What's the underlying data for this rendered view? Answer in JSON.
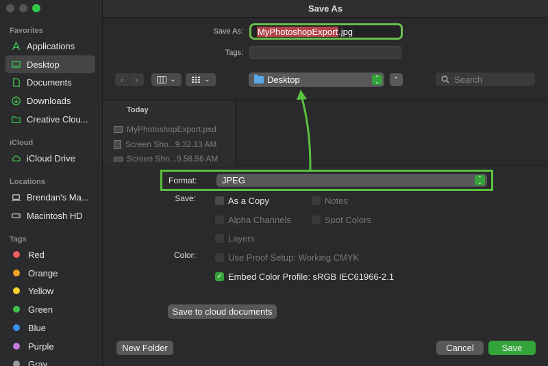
{
  "window": {
    "title": "Save As"
  },
  "sidebar": {
    "favorites_header": "Favorites",
    "favorites": [
      {
        "label": "Applications",
        "icon": "applications-icon"
      },
      {
        "label": "Desktop",
        "icon": "desktop-icon",
        "selected": true
      },
      {
        "label": "Documents",
        "icon": "document-icon"
      },
      {
        "label": "Downloads",
        "icon": "downloads-icon"
      },
      {
        "label": "Creative Clou...",
        "icon": "folder-icon"
      }
    ],
    "icloud_header": "iCloud",
    "icloud": [
      {
        "label": "iCloud Drive",
        "icon": "cloud-icon"
      }
    ],
    "locations_header": "Locations",
    "locations": [
      {
        "label": "Brendan's Ma...",
        "icon": "laptop-icon"
      },
      {
        "label": "Macintosh HD",
        "icon": "drive-icon"
      }
    ],
    "tags_header": "Tags",
    "tags": [
      {
        "label": "Red",
        "color": "#ee5e5c"
      },
      {
        "label": "Orange",
        "color": "#f4a21f"
      },
      {
        "label": "Yellow",
        "color": "#f6d22d"
      },
      {
        "label": "Green",
        "color": "#3dc04b"
      },
      {
        "label": "Blue",
        "color": "#3a8ff0"
      },
      {
        "label": "Purple",
        "color": "#c47be0"
      },
      {
        "label": "Gray",
        "color": "#9a9a9c"
      }
    ]
  },
  "save_as": {
    "label": "Save As:",
    "value_selected": "MyPhotoshopExport",
    "value_ext": ".jpg",
    "tags_label": "Tags:"
  },
  "toolbar": {
    "location": "Desktop",
    "search_placeholder": "Search"
  },
  "browser": {
    "group_header": "Today",
    "files": [
      "MyPhotoshopExport.psd",
      "Screen Sho...9.32.13 AM",
      "Screen Sho...9.58.56 AM"
    ]
  },
  "options": {
    "format_label": "Format:",
    "format_value": "JPEG",
    "save_label": "Save:",
    "as_a_copy": "As a Copy",
    "notes": "Notes",
    "alpha_channels": "Alpha Channels",
    "spot_colors": "Spot Colors",
    "layers": "Layers",
    "color_label": "Color:",
    "use_proof_setup": "Use Proof Setup:  Working CMYK",
    "embed_color_profile": "Embed Color Profile:  sRGB IEC61966-2.1",
    "cloud_button": "Save to cloud documents"
  },
  "footer": {
    "new_folder": "New Folder",
    "cancel": "Cancel",
    "save": "Save"
  },
  "colors": {
    "accent": "#33a43a",
    "annotation": "#5bc13f"
  }
}
